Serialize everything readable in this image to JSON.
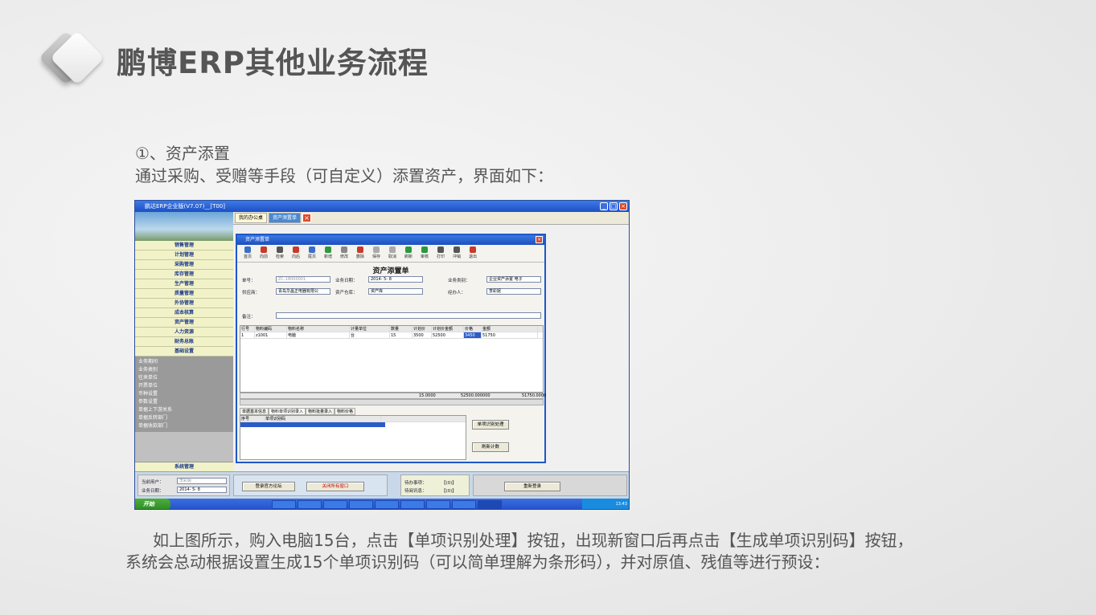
{
  "slide": {
    "title": "鹏博ERP其他业务流程",
    "step_heading": "①、资产添置",
    "intro": "通过采购、受赠等手段（可自定义）添置资产，界面如下：",
    "desc_line1": "如上图所示，购入电脑15台，点击【单项识别处理】按钮，出现新窗口后再点击【生成单项识别码】按钮，",
    "desc_line2": "系统会总动根据设置生成15个单项识别码（可以简单理解为条形码），并对原值、残值等进行预设："
  },
  "erp": {
    "window_title": "鹏达ERP企业版(V7.07)__[T00]",
    "sidebar_menu": [
      "销售管理",
      "计划管理",
      "采购管理",
      "库存管理",
      "生产管理",
      "质量管理",
      "外协管理",
      "成本核算",
      "资产管理",
      "人力资源",
      "财务总账",
      "基础设置"
    ],
    "sidebar_sub": [
      "业务期间",
      "业务类别",
      "往来单位",
      "开票单位",
      "币种设置",
      "参数设置",
      "单据上下游关系",
      "单据反转部门",
      "单据收款部门"
    ],
    "system_button": "系统管理",
    "tabs": [
      "我的办公桌",
      "资产添置单"
    ],
    "form_title": "资产添置单",
    "toolbar": [
      "首页",
      "向前",
      "检索",
      "向后",
      "尾页",
      "新增",
      "修改",
      "删除",
      "保存",
      "取消",
      "刷新",
      "审核",
      "打印",
      "冲销",
      "退出"
    ],
    "doc_title": "资产添置单",
    "fields": {
      "no_label": "单号：",
      "no_value": "ZC-18000001",
      "date_label": "业务日期：",
      "date_value": "2014- 5- 8",
      "type_label": "业务类别：",
      "type_value": "企业资产添置 电子",
      "supplier_label": "供应商：",
      "supplier_value": "青岛华晶正电器有限公",
      "warehouse_label": "资产仓库：",
      "warehouse_value": "资产库",
      "handler_label": "经办人：",
      "handler_value": "李彩妮",
      "remark_label": "备注："
    },
    "grid_headers": [
      "行号",
      "物料编码",
      "物料名称",
      "计量单位",
      "数量",
      "计划价",
      "计划价金额",
      "价格",
      "金额"
    ],
    "grid_rows": [
      [
        "1",
        "z1001",
        "电脑",
        "台",
        "15",
        "3500",
        "52500",
        "3450",
        "51750"
      ]
    ],
    "grid_sum": [
      "15.0000",
      "52500.000000",
      "51750.0000"
    ],
    "subtabs": [
      "单据基本信息",
      "物料单项识别录入",
      "物料批量录入",
      "物料价格"
    ],
    "subgrid_headers": [
      "序号",
      "单项识别码"
    ],
    "btn_process": "单项识别处理",
    "btn_refresh": "刷新计数",
    "bottom": {
      "user_label": "当前用户：",
      "user_value": "李彩妮",
      "date_label": "业务日期：",
      "date_value": "2014- 5- 8",
      "forum_btn": "登录官方论坛",
      "close_all_btn": "关闭所有窗口",
      "todo_label": "待办事项：",
      "todo_value": "【(0)】",
      "msg_label": "待阅讯息：",
      "msg_value": "【(0)】",
      "logout_btn": "重新登录"
    },
    "start": "开始",
    "clock": "13:43"
  }
}
